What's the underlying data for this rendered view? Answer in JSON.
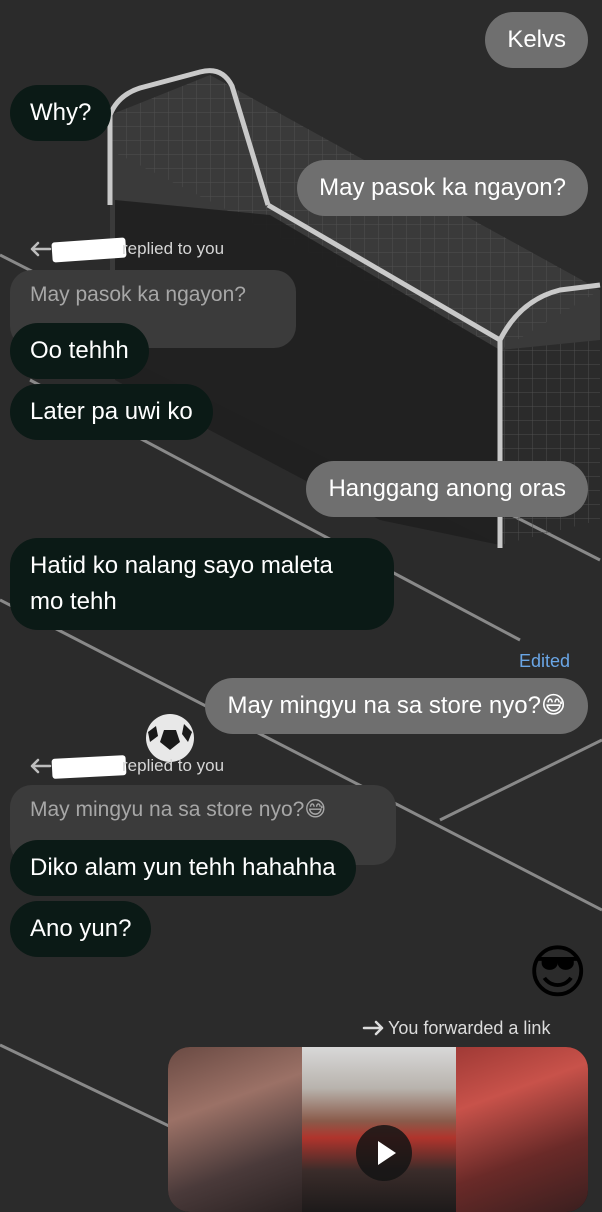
{
  "messages": {
    "m1": {
      "text": "Kelvs"
    },
    "m2": {
      "text": "Why?"
    },
    "m3": {
      "text": "May pasok ka ngayon?"
    },
    "r1": {
      "label": "replied to you",
      "quote": "May pasok ka ngayon?"
    },
    "m4": {
      "text": "Oo tehhh"
    },
    "m5": {
      "text": "Later pa uwi ko"
    },
    "m6": {
      "text": "Hanggang anong oras"
    },
    "m7": {
      "line1": "Hatid ko nalang sayo maleta",
      "line2": "mo tehh"
    },
    "m8": {
      "edited": "Edited",
      "text": "May mingyu na sa store nyo?",
      "emoji": "😅"
    },
    "r2": {
      "label": "replied to you",
      "quote": "May mingyu na sa store nyo?",
      "emoji": "😅"
    },
    "m9": {
      "text": "Diko alam yun tehh hahahha"
    },
    "m10": {
      "text": "Ano yun?"
    },
    "m11": {
      "emoji": "😎"
    },
    "fwd": {
      "label": "You forwarded a link"
    }
  },
  "colors": {
    "background": "#2b2b2b",
    "sent_bubble": "#6f6f6f",
    "received_bubble": "#0b1a16",
    "quote_bubble": "#3b3b3b",
    "edited_text": "#6aa6e6"
  },
  "icons": {
    "reply": "reply-arrow-icon",
    "forward": "forward-arrow-icon",
    "play": "play-icon",
    "theme_ball": "soccer-ball-icon"
  }
}
